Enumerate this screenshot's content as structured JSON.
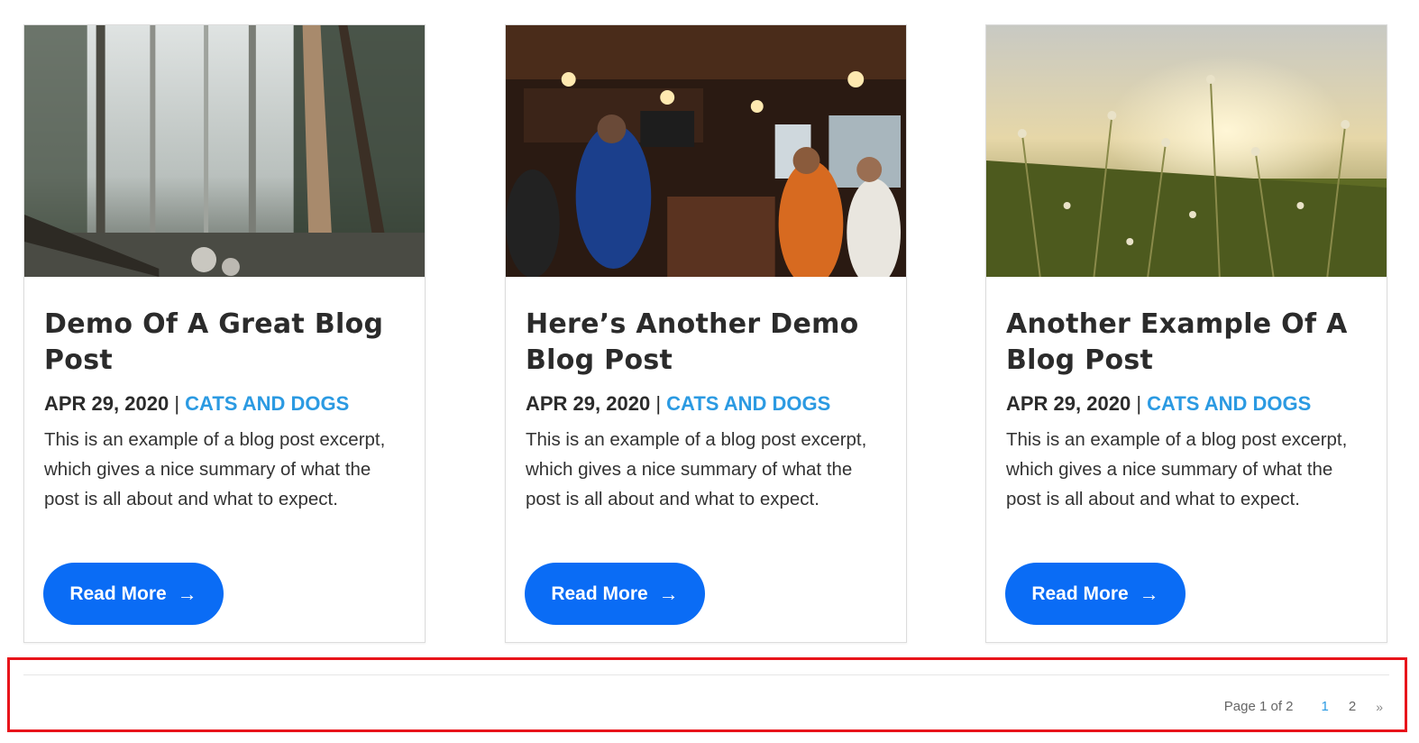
{
  "posts": [
    {
      "title": "Demo Of A Great Blog Post",
      "date": "APR 29, 2020",
      "separator": "|",
      "category": "CATS AND DOGS",
      "excerpt": "This is an example of a blog post excerpt, which gives a nice summary of what the post is all about and what to expect.",
      "button_label": "Read More",
      "button_icon": "arrow-right-icon"
    },
    {
      "title": "Here’s Another Demo Blog Post",
      "date": "APR 29, 2020",
      "separator": "|",
      "category": "CATS AND DOGS",
      "excerpt": "This is an example of a blog post excerpt, which gives a nice summary of what the post is all about and what to expect.",
      "button_label": "Read More",
      "button_icon": "arrow-right-icon"
    },
    {
      "title": "Another Example Of A Blog Post",
      "date": "APR 29, 2020",
      "separator": "|",
      "category": "CATS AND DOGS",
      "excerpt": "This is an example of a blog post excerpt, which gives a nice summary of what the post is all about and what to expect.",
      "button_label": "Read More",
      "button_icon": "arrow-right-icon"
    }
  ],
  "pagination": {
    "info": "Page 1 of 2",
    "pages": [
      "1",
      "2"
    ],
    "current": "1",
    "next": "»"
  },
  "colors": {
    "accent": "#2b9ae2",
    "button": "#0a6cf5",
    "highlight": "#e8141b"
  }
}
